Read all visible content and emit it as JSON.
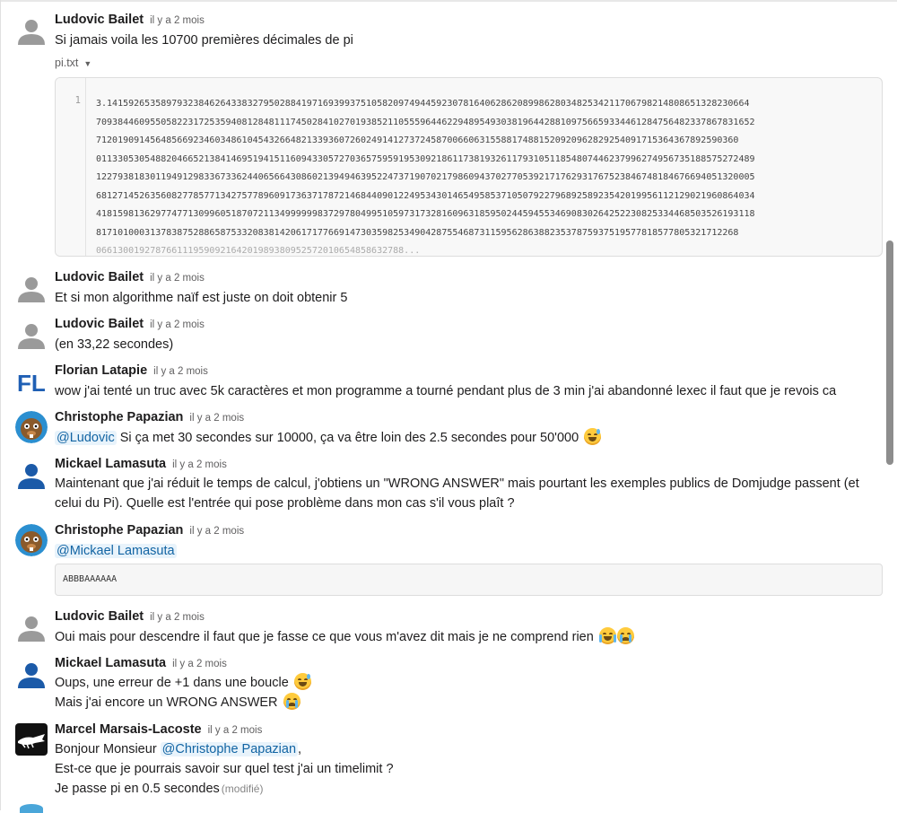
{
  "messages": [
    {
      "author": "Ludovic Bailet",
      "time": "il y a 2 mois",
      "avatar": "default-user-avatar",
      "lines": [
        "Si jamais voila les 10700 premières décimales de pi"
      ],
      "file": {
        "name": "pi.txt",
        "line_number": "1",
        "content_lines": [
          "3.14159265358979323846264338327950288419716939937510582097494459230781640628620899862803482534211706798214808651328230664",
          "70938446095505822317253594081284811174502841027019385211055596446229489549303819644288109756659334461284756482337867831652",
          "71201909145648566923460348610454326648213393607260249141273724587006606315588174881520920962829254091715364367892590360",
          "01133053054882046652138414695194151160943305727036575959195309218611738193261179310511854807446237996274956735188575272489",
          "12279381830119491298336733624406566430860213949463952247371907021798609437027705392171762931767523846748184676694051320005",
          "68127145263560827785771342757789609173637178721468440901224953430146549585371050792279689258923542019956112129021960864034",
          "41815981362977477130996051870721134999999837297804995105973173281609631859502445945534690830264252230825334468503526193118",
          "81710100031378387528865875332083814206171776691473035982534904287554687311595628638823537875937519577818577805321712268",
          "066130019278766111959092164201989380952572010654858632788..."
        ]
      }
    },
    {
      "author": "Ludovic Bailet",
      "time": "il y a 2 mois",
      "avatar": "default-user-avatar",
      "lines": [
        "Et si mon algorithme naïf est juste on doit obtenir 5"
      ]
    },
    {
      "author": "Ludovic Bailet",
      "time": "il y a 2 mois",
      "avatar": "default-user-avatar",
      "lines": [
        "(en 33,22 secondes)"
      ]
    },
    {
      "author": "Florian Latapie",
      "time": "il y a 2 mois",
      "avatar": "FL",
      "lines": [
        "wow j'ai tenté un truc avec 5k caractères et mon programme a tourné pendant plus de 3 min j'ai abandonné lexec il faut que je revois ca"
      ]
    },
    {
      "author": "Christophe Papazian",
      "time": "il y a 2 mois",
      "avatar": "beaver-avatar",
      "mention": "@Ludovic",
      "text": " Si ça met 30 secondes sur 10000, ça va être loin des 2.5 secondes pour 50'000",
      "emoji": "sweat-smile-emoji"
    },
    {
      "author": "Mickael Lamasuta",
      "time": "il y a 2 mois",
      "avatar": "blue-user-avatar",
      "paragraph": "Maintenant que j'ai réduit le temps de calcul, j'obtiens un \"WRONG ANSWER\" mais pourtant les exemples publics de Domjudge passent (et celui du Pi). Quelle est l'entrée qui pose problème dans mon cas s'il vous plaît ?"
    },
    {
      "author": "Christophe Papazian",
      "time": "il y a 2 mois",
      "avatar": "beaver-avatar",
      "mention": "@Mickael Lamasuta",
      "snippet": "ABBBAAAAAA"
    },
    {
      "author": "Ludovic Bailet",
      "time": "il y a 2 mois",
      "avatar": "default-user-avatar",
      "text": "Oui mais pour descendre il faut que je fasse ce que vous m'avez dit mais je ne comprend rien",
      "emojis": [
        "laughing-tears-emoji",
        "crying-emoji"
      ]
    },
    {
      "author": "Mickael Lamasuta",
      "time": "il y a 2 mois",
      "avatar": "blue-user-avatar",
      "line1": "Oups, une erreur de +1 dans une boucle",
      "line2": "Mais j'ai encore un WRONG ANSWER",
      "emoji1": "sweat-smile-emoji",
      "emoji2": "crying-emoji"
    },
    {
      "author": "Marcel Marsais-Lacoste",
      "time": "il y a 2 mois",
      "avatar": "crocodile-logo-avatar",
      "line1_prefix": "Bonjour Monsieur ",
      "mention": "@Christophe Papazian",
      "line1_suffix": ",",
      "line2": "Est-ce que je pourrais savoir sur quel test j'ai un timelimit ?",
      "line3": "Je passe pi en 0.5 secondes",
      "edited": "(modifié)"
    }
  ],
  "colors": {
    "mention_bg": "#e8f3fb",
    "mention_text": "#1264a3",
    "fl_logo": "#1f5fb4",
    "blue_user": "#1b5aa8"
  }
}
